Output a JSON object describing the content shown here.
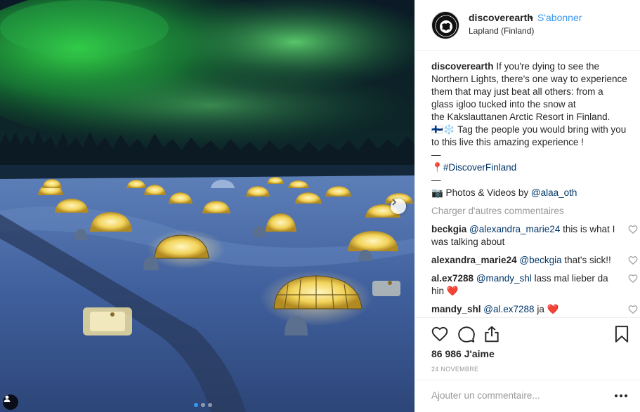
{
  "post": {
    "header": {
      "username": "discoverearth",
      "separator": "•",
      "follow_label": "S'abonner",
      "location": "Lapland (Finland)"
    },
    "caption": {
      "username": "discoverearth",
      "lines": [
        "If you're dying to see the",
        "Northern Lights, there's one way to experience",
        "them that may just beat all others: from a",
        "glass igloo tucked into the snow at",
        "the Kakslauttanen Arctic Resort in Finland."
      ],
      "flag_line": "🇫🇮❄️ Tag the people you would bring with you",
      "flag_line_2": "to this live this amazing experience !",
      "dash_1": "—",
      "hashtag_pin": "📍",
      "hashtag": "#DiscoverFinland",
      "dash_2": "—",
      "credit_prefix": "📷 Photos & Videos by ",
      "credit_user": "@alaa_oth"
    },
    "load_more_label": "Charger d'autres commentaires",
    "comments": [
      {
        "user": "beckgia",
        "mention": "@alexandra_marie24",
        "text": " this is what I was talking about"
      },
      {
        "user": "alexandra_marie24",
        "mention": "@beckgia",
        "text": " that's sick!!"
      },
      {
        "user": "al.ex7288",
        "mention": "@mandy_shl",
        "text": " lass mal lieber da hin ❤️"
      },
      {
        "user": "mandy_shl",
        "mention": "@al.ex7288",
        "text": " ja ❤️"
      }
    ],
    "likes_label": "86 986 J'aime",
    "date_label": "24 NOVEMBRE",
    "add_comment_placeholder": "Ajouter un commentaire...",
    "carousel": {
      "count": 3,
      "active_index": 0
    },
    "icons": {
      "like": "heart-outline-icon",
      "comment": "comment-bubble-icon",
      "share": "share-icon",
      "save": "bookmark-icon",
      "more": "more-dots-icon",
      "next": "chevron-right-icon",
      "tag": "user-tag-icon"
    },
    "colors": {
      "link": "#003569",
      "follow": "#3897f0",
      "muted": "#999999",
      "heart_red": "#ed4956"
    }
  }
}
